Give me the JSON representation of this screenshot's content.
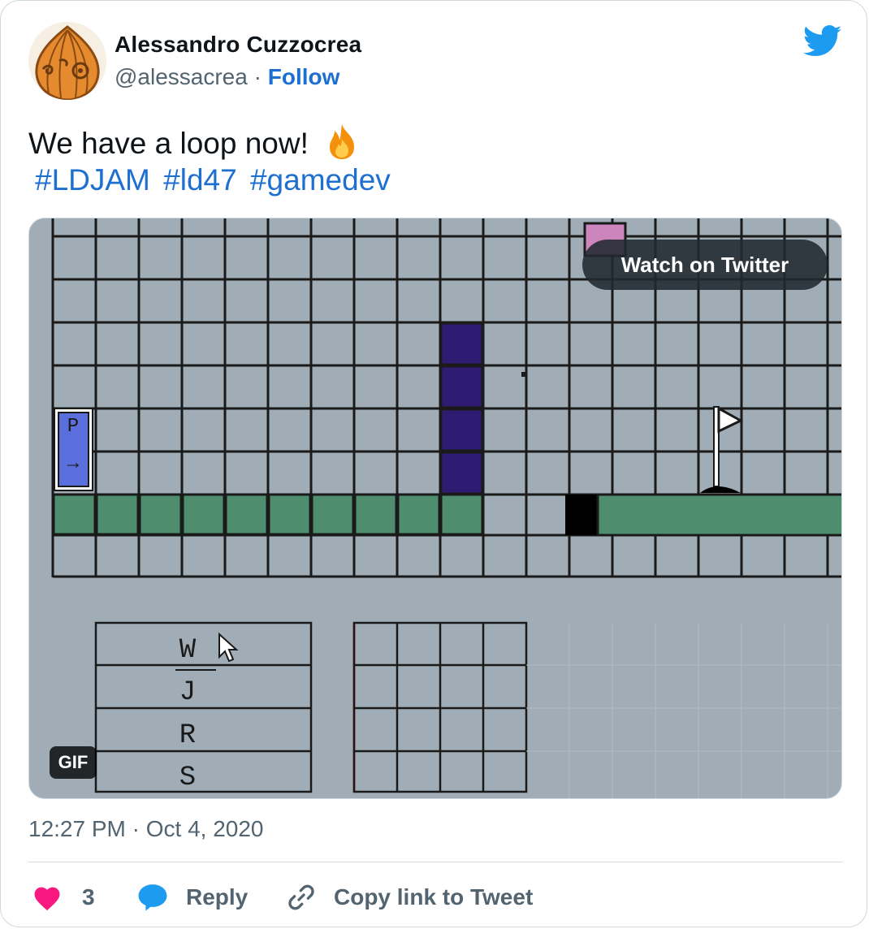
{
  "tweet": {
    "author": {
      "name": "Alessandro Cuzzocrea",
      "handle": "@alessacrea",
      "separator": "·",
      "follow_label": "Follow"
    },
    "text": "We have a loop now!",
    "emoji": "fire-emoji",
    "hashtags": [
      "#LDJAM",
      "#ld47",
      "#gamedev"
    ],
    "media": {
      "watch_label": "Watch on Twitter",
      "badge": "GIF",
      "grid_labels": [
        "W",
        "J",
        "R",
        "S"
      ],
      "spawn_tile": [
        "P",
        "→"
      ]
    },
    "timestamp": "12:27 PM · Oct 4, 2020",
    "actions": {
      "like_count": "3",
      "reply_label": "Reply",
      "copy_label": "Copy link to Tweet"
    }
  },
  "icons": {
    "brand": "twitter-bird-icon",
    "like": "heart-icon",
    "reply": "speech-bubble-icon",
    "copy": "link-icon"
  },
  "colors": {
    "link": "#1d6fd1",
    "heart": "#f91880",
    "bird": "#1d9bf0",
    "muted": "#536471",
    "game_bg": "#a0adb6",
    "platform": "#4e8e6e",
    "wall": "#2e1c72",
    "spawn": "#5a6fdb",
    "pink_block": "#cc85bd"
  }
}
